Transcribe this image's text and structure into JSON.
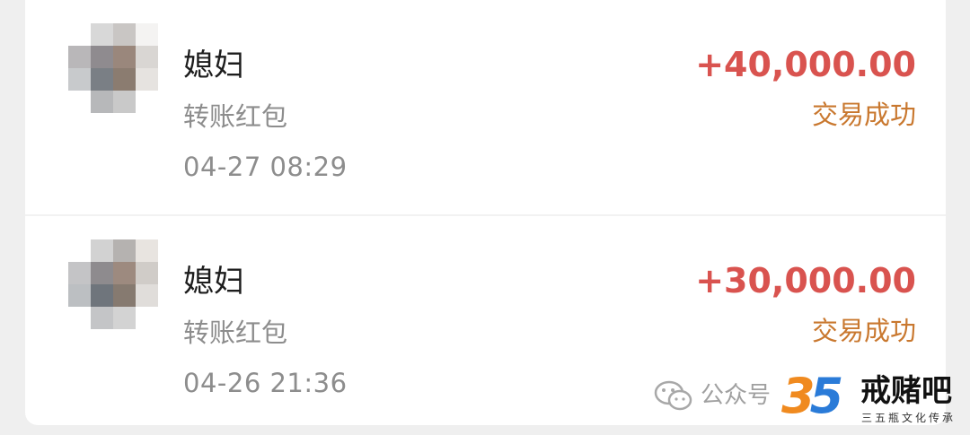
{
  "transactions": [
    {
      "name": "媳妇",
      "type": "转账红包",
      "time": "04-27 08:29",
      "amount": "+40,000.00",
      "status": "交易成功"
    },
    {
      "name": "媳妇",
      "type": "转账红包",
      "time": "04-26 21:36",
      "amount": "+30,000.00",
      "status": "交易成功"
    }
  ],
  "colors": {
    "amount": "#d9534f",
    "status": "#c9782f",
    "name": "#1d1d1d",
    "secondary": "#8d8d8d"
  },
  "watermark": {
    "icon": "wechat-icon",
    "source_label": "公众号",
    "logo_digits": "35",
    "brand": "戒赌吧",
    "slogan": "三五瓶文化传承"
  }
}
